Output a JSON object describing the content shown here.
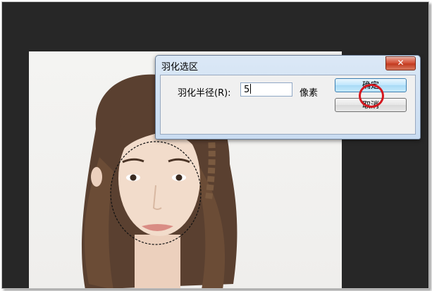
{
  "dialog": {
    "title": "羽化选区",
    "close_glyph": "✕",
    "radius_label": "羽化半径(R):",
    "radius_value": "5",
    "unit_label": "像素",
    "ok_label": "确定",
    "cancel_label": "取消"
  },
  "colors": {
    "canvas_bg": "#272727",
    "highlight": "#d5181f"
  }
}
